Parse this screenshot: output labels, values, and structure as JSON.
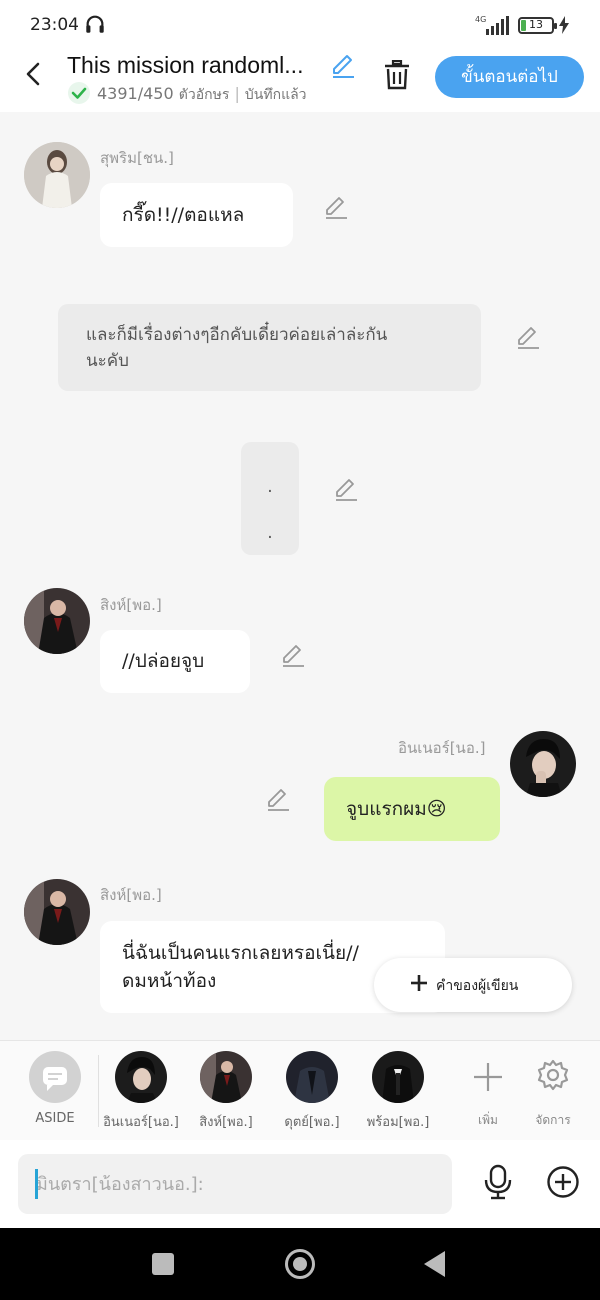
{
  "status_bar": {
    "time": "23:04",
    "network": "4G",
    "battery": "13"
  },
  "header": {
    "title": "This mission randoml...",
    "char_count": "4391/450",
    "char_unit": "ตัวอักษร",
    "saved": "บันทึกแล้ว",
    "next_button": "ขั้นตอนต่อไป"
  },
  "messages": {
    "m1": {
      "name": "สุพริม[ชน.]",
      "text": "กรี๊ด!!//ตอแหล"
    },
    "m2": {
      "line1": "และก็มีเรื่องต่างๆอีกคับเดี๋ยวค่อยเล่าล่ะกัน",
      "line2": "นะคับ"
    },
    "m3": {
      "line1": ".",
      "line2": "."
    },
    "m4": {
      "name": "สิงห์[พอ.]",
      "text": "//ปล่อยจูบ"
    },
    "m5": {
      "name": "อินเนอร์[นอ.]",
      "text": "จูบแรกผม😢"
    },
    "m6": {
      "name": "สิงห์[พอ.]",
      "line1": "นี่ฉันเป็นคนแรกเลยหรอเนี่ย//",
      "line2": "ดมหน้าท้อง"
    }
  },
  "writer_note_button": "คำของผู้เขียน",
  "characters": [
    {
      "label": "ASIDE"
    },
    {
      "label": "อินเนอร์[นอ.]"
    },
    {
      "label": "สิงห์[พอ.]"
    },
    {
      "label": "ดุตย์[พอ.]"
    },
    {
      "label": "พร้อม[พอ.]"
    }
  ],
  "char_actions": {
    "add": "เพิ่ม",
    "manage": "จัดการ"
  },
  "composer": {
    "placeholder": "มินตรา[น้องสาวนอ.]:"
  },
  "colors": {
    "accent": "#4aa3f0",
    "my_bubble": "#dcf6a7",
    "check": "#2db34a"
  }
}
